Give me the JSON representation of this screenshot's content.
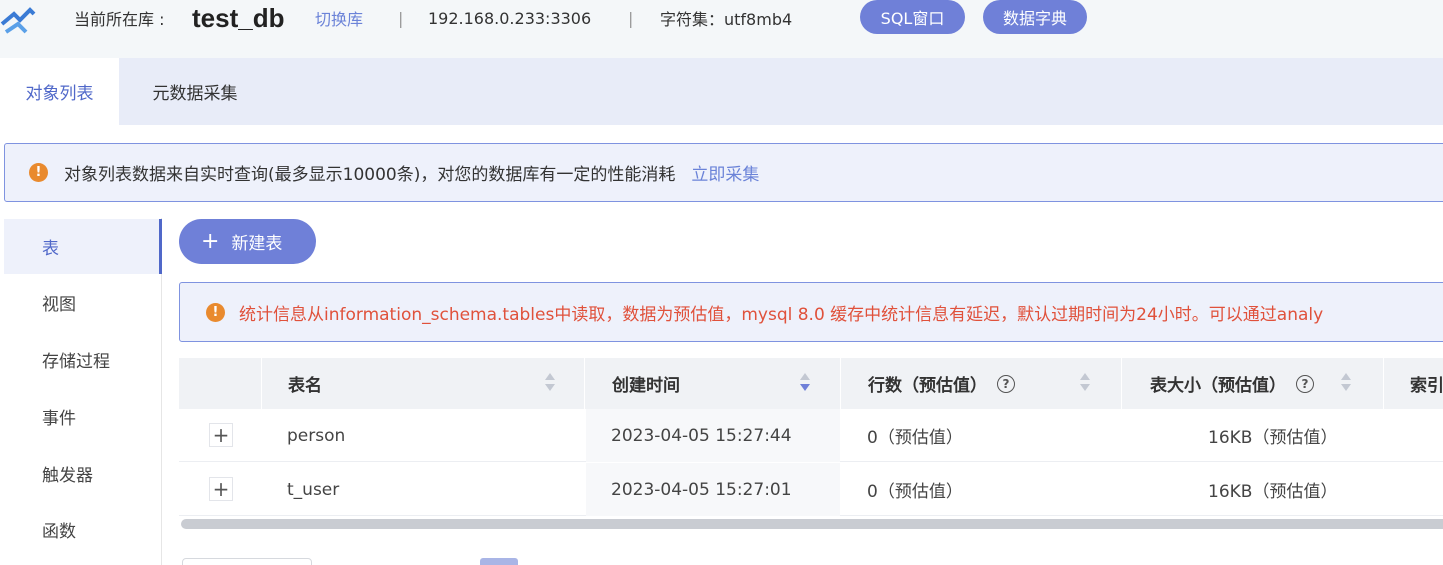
{
  "header": {
    "current_db_label": "当前所在库 :",
    "db_name": "test_db",
    "switch_label": "切换库",
    "separator": "|",
    "host": "192.168.0.233:3306",
    "charset": "字符集：utf8mb4",
    "sql_window_label": "SQL窗口",
    "data_dict_label": "数据字典"
  },
  "tabs": [
    {
      "label": "对象列表",
      "active": true
    },
    {
      "label": "元数据采集",
      "active": false
    }
  ],
  "alert": {
    "text": "对象列表数据来自实时查询(最多显示10000条)，对您的数据库有一定的性能消耗",
    "link": "立即采集"
  },
  "sidenav": {
    "items": [
      {
        "label": "表",
        "active": true
      },
      {
        "label": "视图"
      },
      {
        "label": "存储过程"
      },
      {
        "label": "事件"
      },
      {
        "label": "触发器"
      },
      {
        "label": "函数"
      }
    ]
  },
  "new_table_button": {
    "icon": "+",
    "label": "新建表"
  },
  "stats_warning": {
    "text": "统计信息从information_schema.tables中读取，数据为预估值，mysql 8.0 缓存中统计信息有延迟，默认过期时间为24小时。可以通过analy"
  },
  "table": {
    "columns": [
      "表名",
      "创建时间",
      "行数（预估值）",
      "表大小（预估值）",
      "索引"
    ],
    "help_icon": "?",
    "expand_icon": "+",
    "rows": [
      {
        "name": "person",
        "created": "2023-04-05 15:27:44",
        "rows": "0（预估值）",
        "size": "16KB（预估值）"
      },
      {
        "name": "t_user",
        "created": "2023-04-05 15:27:01",
        "rows": "0（预估值）",
        "size": "16KB（预估值）"
      }
    ]
  },
  "colors": {
    "accent": "#6f80d8",
    "link": "#6b83d8",
    "warning_text": "#e0513b",
    "warning_icon": "#e98a2e"
  }
}
